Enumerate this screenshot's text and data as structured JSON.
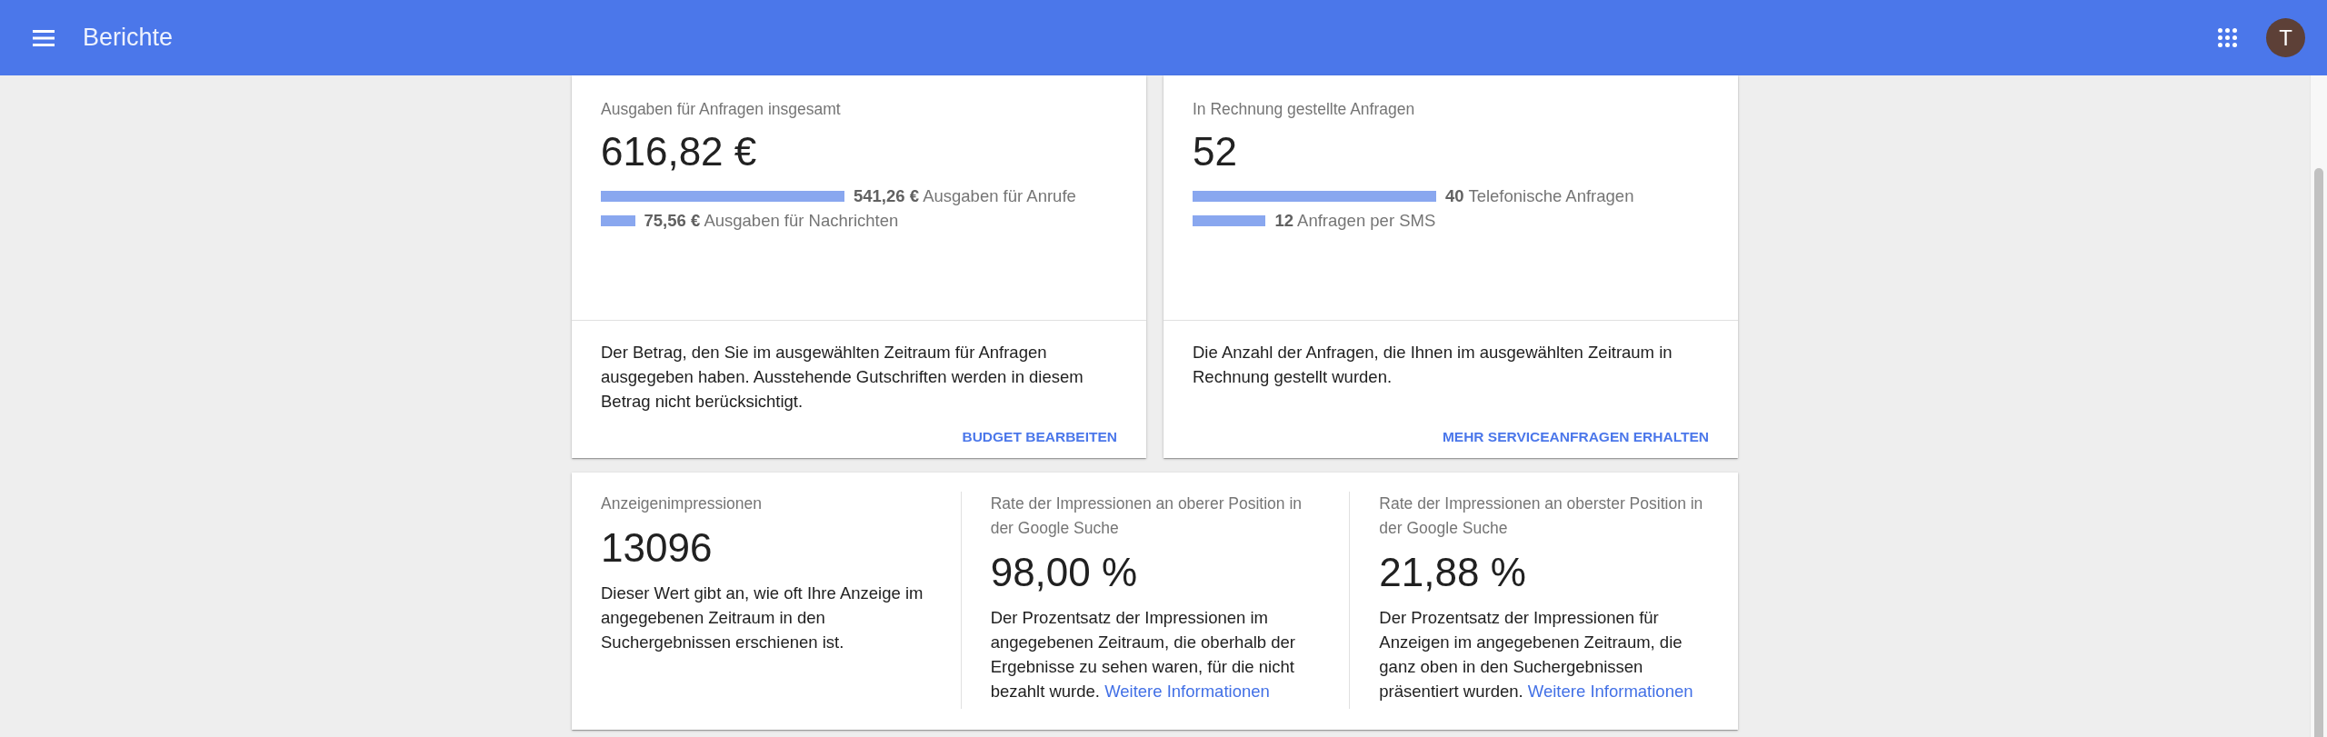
{
  "app_bar": {
    "title": "Berichte",
    "avatar_initial": "T"
  },
  "summary_cards": [
    {
      "label": "Ausgaben für Anfragen insgesamt",
      "value": "616,82 €",
      "breakdown": [
        {
          "text": "**541,26 €** Ausgaben für Anrufe",
          "level": 1
        },
        {
          "text": "**75,56 €** Ausgaben für Nachrichten",
          "level": 0.14
        }
      ],
      "description": "Der Betrag, den Sie im ausgewählten Zeitraum für Anfragen ausgegeben haben. Ausstehende Gutschriften werden in diesem Betrag nicht berücksichtigt.",
      "action": "BUDGET BEARBEITEN"
    },
    {
      "label": "In Rechnung gestellte Anfragen",
      "value": "52",
      "breakdown": [
        {
          "text": "**40** Telefonische Anfragen",
          "level": 1
        },
        {
          "text": "**12** Anfragen per SMS",
          "level": 0.3
        }
      ],
      "description": "Die Anzahl der Anfragen, die Ihnen im ausgewählten Zeitraum in Rechnung gestellt wurden.",
      "action": "MEHR SERVICEANFRAGEN ERHALTEN"
    }
  ],
  "impressions_card": {
    "metrics": [
      {
        "label": "Anzeigenimpressionen",
        "value": "13096",
        "description": "Dieser Wert gibt an, wie oft Ihre Anzeige im angegebenen Zeitraum in den Suchergebnissen erschienen ist."
      },
      {
        "label": "Rate der Impressionen an oberer Position in der Google Suche",
        "value": "98,00 %",
        "description": "Der Prozentsatz der Impressionen im angegebenen Zeitraum, die oberhalb der Ergebnisse zu sehen waren, für die nicht bezahlt wurde.",
        "link": "Weitere Informationen"
      },
      {
        "label": "Rate der Impressionen an oberster Position in der Google Suche",
        "value": "21,88 %",
        "description": "Der Prozentsatz der Impressionen für Anzeigen im angegebenen Zeitraum, die ganz oben in den Suchergebnissen präsentiert wurden.",
        "link": "Weitere Informationen"
      }
    ]
  }
}
